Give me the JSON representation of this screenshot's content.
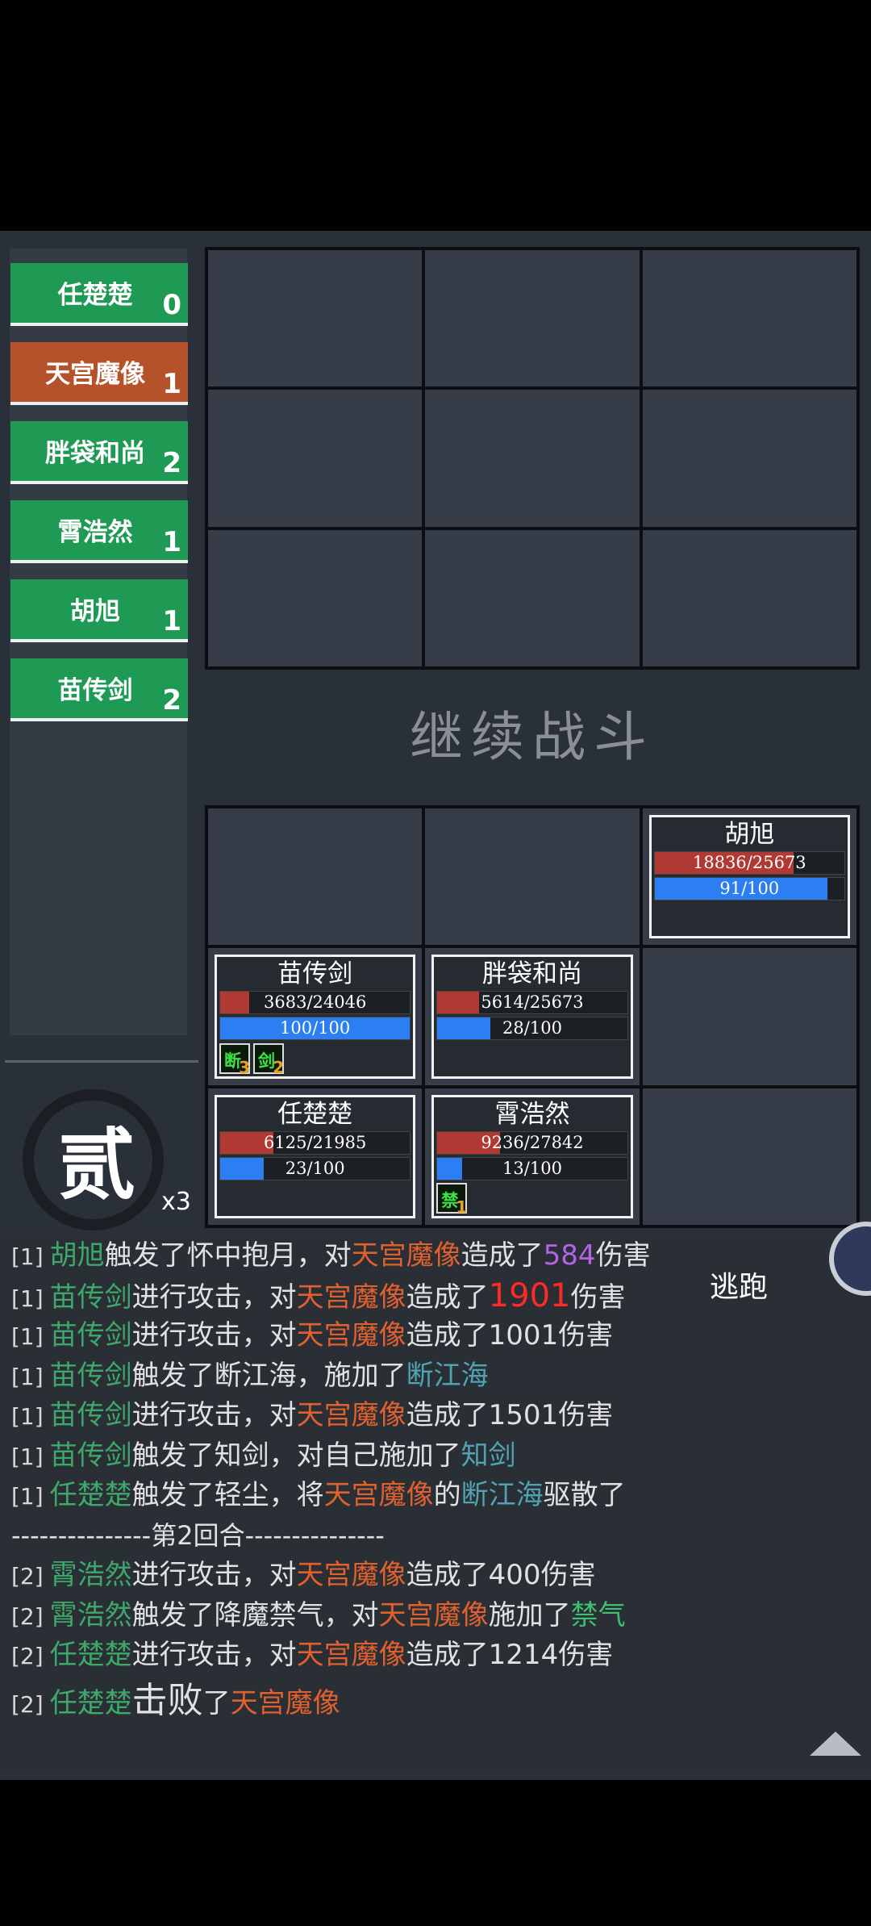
{
  "turn_order": [
    {
      "name": "任楚楚",
      "count": "0",
      "color": "green"
    },
    {
      "name": "天宫魔像",
      "count": "1",
      "color": "red"
    },
    {
      "name": "胖袋和尚",
      "count": "2",
      "color": "green"
    },
    {
      "name": "霄浩然",
      "count": "1",
      "color": "green"
    },
    {
      "name": "胡旭",
      "count": "1",
      "color": "green"
    },
    {
      "name": "苗传剑",
      "count": "2",
      "color": "green"
    }
  ],
  "round_label": "贰",
  "speed_label": "x3",
  "continue_label": "继续战斗",
  "units": {
    "huxu": {
      "name": "胡旭",
      "hp_text": "18836/25673",
      "hp": 0.733,
      "mp_text": "91/100",
      "mp": 0.91
    },
    "miao": {
      "name": "苗传剑",
      "hp_text": "3683/24046",
      "hp": 0.153,
      "mp_text": "100/100",
      "mp": 1.0,
      "buffs": [
        {
          "icon": "断",
          "count": "3"
        },
        {
          "icon": "剑",
          "count": "2"
        }
      ]
    },
    "pang": {
      "name": "胖袋和尚",
      "hp_text": "5614/25673",
      "hp": 0.219,
      "mp_text": "28/100",
      "mp": 0.28
    },
    "ren": {
      "name": "任楚楚",
      "hp_text": "6125/21985",
      "hp": 0.279,
      "mp_text": "23/100",
      "mp": 0.23
    },
    "xiao": {
      "name": "霄浩然",
      "hp_text": "9236/27842",
      "hp": 0.332,
      "mp_text": "13/100",
      "mp": 0.13,
      "buffs": [
        {
          "icon": "禁",
          "count": "1"
        }
      ]
    }
  },
  "flee_label": "逃跑",
  "log": [
    {
      "tag": "[1]",
      "parts": [
        [
          "胡旭",
          "cg"
        ],
        [
          "触发了怀中抱月，对",
          ""
        ],
        [
          "天宫魔像",
          "co"
        ],
        [
          "造成了",
          ""
        ],
        [
          "584",
          "cp"
        ],
        [
          "伤害",
          ""
        ]
      ]
    },
    {
      "tag": "[1]",
      "parts": [
        [
          "苗传剑",
          "cg"
        ],
        [
          "进行攻击，对",
          ""
        ],
        [
          "天宫魔像",
          "co"
        ],
        [
          "造成了",
          ""
        ],
        [
          "1901",
          "cr"
        ],
        [
          "伤害",
          ""
        ]
      ]
    },
    {
      "tag": "[1]",
      "parts": [
        [
          "苗传剑",
          "cg"
        ],
        [
          "进行攻击，对",
          ""
        ],
        [
          "天宫魔像",
          "co"
        ],
        [
          "造成了1001伤害",
          ""
        ]
      ]
    },
    {
      "tag": "[1]",
      "parts": [
        [
          "苗传剑",
          "cg"
        ],
        [
          "触发了断江海，施加了",
          ""
        ],
        [
          "断江海",
          "cb"
        ]
      ]
    },
    {
      "tag": "[1]",
      "parts": [
        [
          "苗传剑",
          "cg"
        ],
        [
          "进行攻击，对",
          ""
        ],
        [
          "天宫魔像",
          "co"
        ],
        [
          "造成了1501伤害",
          ""
        ]
      ]
    },
    {
      "tag": "[1]",
      "parts": [
        [
          "苗传剑",
          "cg"
        ],
        [
          "触发了知剑，对自己施加了",
          ""
        ],
        [
          "知剑",
          "cb"
        ]
      ]
    },
    {
      "tag": "[1]",
      "parts": [
        [
          "任楚楚",
          "cg"
        ],
        [
          "触发了轻尘，将",
          ""
        ],
        [
          "天宫魔像",
          "co"
        ],
        [
          "的",
          ""
        ],
        [
          "断江海",
          "cb"
        ],
        [
          "驱散了",
          ""
        ]
      ]
    },
    {
      "tag": "",
      "parts": [
        [
          "---------------第2回合---------------",
          "divider"
        ]
      ]
    },
    {
      "tag": "[2]",
      "parts": [
        [
          "霄浩然",
          "cg"
        ],
        [
          "进行攻击，对",
          ""
        ],
        [
          "天宫魔像",
          "co"
        ],
        [
          "造成了400伤害",
          ""
        ]
      ]
    },
    {
      "tag": "[2]",
      "parts": [
        [
          "霄浩然",
          "cg"
        ],
        [
          "触发了降魔禁气，对",
          ""
        ],
        [
          "天宫魔像",
          "co"
        ],
        [
          "施加了",
          ""
        ],
        [
          "禁气",
          "cgb"
        ]
      ]
    },
    {
      "tag": "[2]",
      "parts": [
        [
          "任楚楚",
          "cg"
        ],
        [
          "进行攻击，对",
          ""
        ],
        [
          "天宫魔像",
          "co"
        ],
        [
          "造成了1214伤害",
          ""
        ]
      ]
    },
    {
      "tag": "[2]",
      "parts": [
        [
          "任楚楚",
          "cg"
        ],
        [
          "击败",
          "big"
        ],
        [
          "了",
          ""
        ],
        [
          "天宫魔像",
          "co"
        ]
      ]
    }
  ]
}
